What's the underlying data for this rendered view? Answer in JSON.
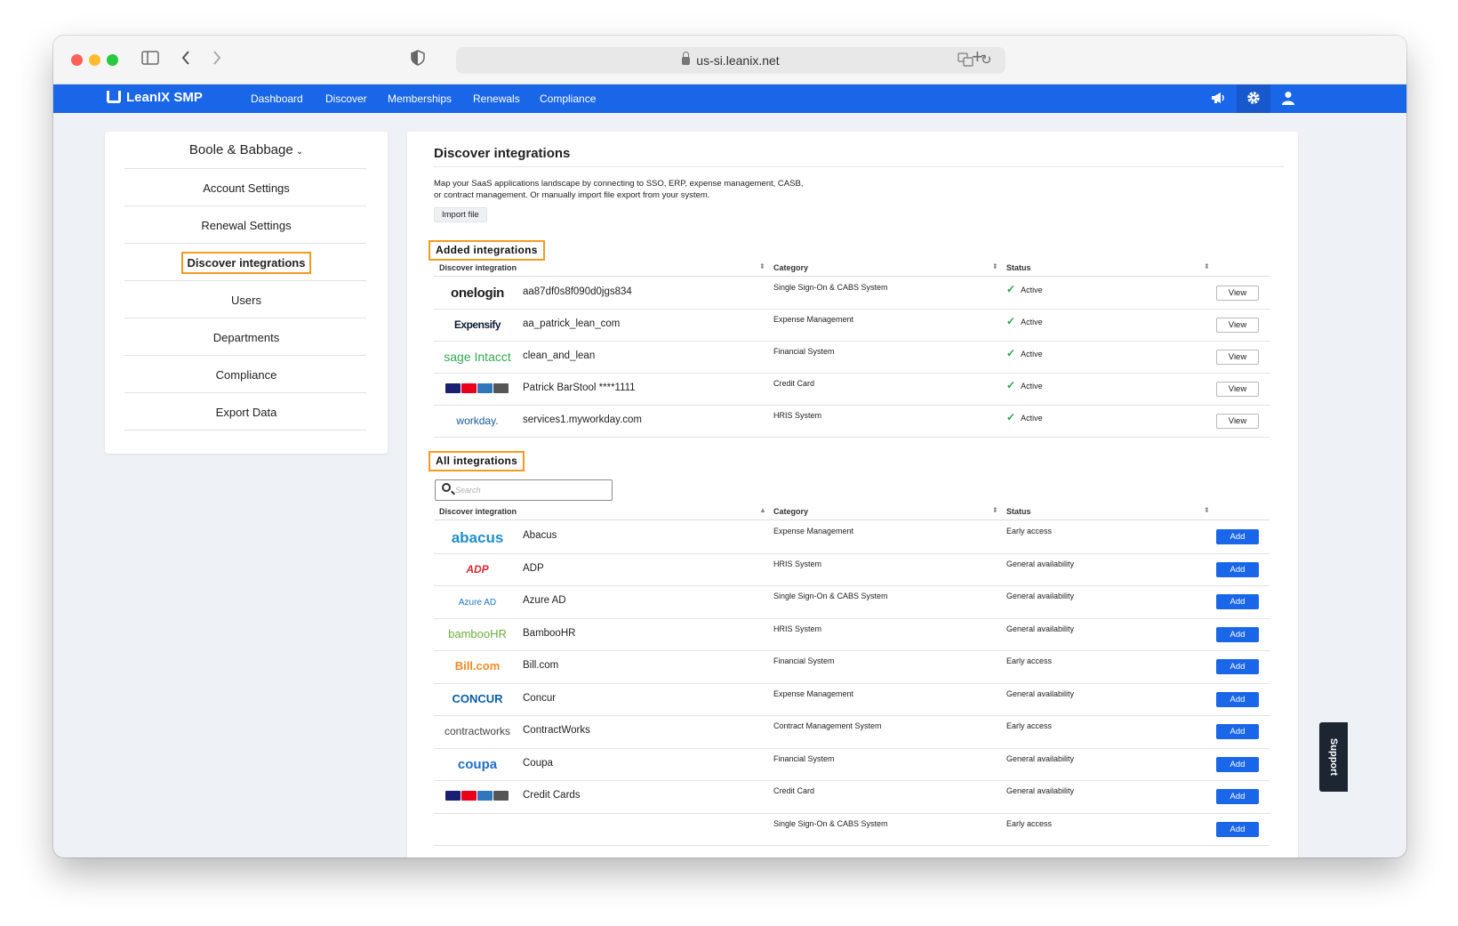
{
  "browser": {
    "url": "us-si.leanix.net"
  },
  "nav": {
    "brand": "LeanIX SMP",
    "items": [
      "Dashboard",
      "Discover",
      "Memberships",
      "Renewals",
      "Compliance"
    ]
  },
  "sidebar": {
    "org": "Boole & Babbage",
    "items": [
      "Account Settings",
      "Renewal Settings",
      "Discover integrations",
      "Users",
      "Departments",
      "Compliance",
      "Export Data"
    ]
  },
  "main": {
    "title": "Discover integrations",
    "description": "Map your SaaS applications landscape by connecting to SSO, ERP, expense management, CASB, or contract management. Or manually import file export from your system.",
    "import_label": "Import file",
    "added_label": "Added integrations",
    "all_label": "All integrations",
    "search_placeholder": "Search",
    "columns": {
      "integration": "Discover integration",
      "category": "Category",
      "status": "Status"
    },
    "view_label": "View",
    "add_label": "Add",
    "added": [
      {
        "logo": "onelogin",
        "name": "aa87df0s8f090d0jgs834",
        "category": "Single Sign-On & CABS System",
        "status": "Active"
      },
      {
        "logo": "Expensify",
        "name": "aa_patrick_lean_com",
        "category": "Expense Management",
        "status": "Active"
      },
      {
        "logo": "sage Intacct",
        "name": "clean_and_lean",
        "category": "Financial System",
        "status": "Active"
      },
      {
        "logo": "credit-cards",
        "name": "Patrick BarStool ****1111",
        "category": "Credit Card",
        "status": "Active"
      },
      {
        "logo": "workday.",
        "name": "services1.myworkday.com",
        "category": "HRIS System",
        "status": "Active"
      }
    ],
    "all": [
      {
        "logo": "abacus",
        "name": "Abacus",
        "category": "Expense Management",
        "status": "Early access"
      },
      {
        "logo": "ADP",
        "name": "ADP",
        "category": "HRIS System",
        "status": "General availability"
      },
      {
        "logo": "Azure AD",
        "name": "Azure AD",
        "category": "Single Sign-On & CABS System",
        "status": "General availability"
      },
      {
        "logo": "bambooHR",
        "name": "BambooHR",
        "category": "HRIS System",
        "status": "General availability"
      },
      {
        "logo": "Bill.com",
        "name": "Bill.com",
        "category": "Financial System",
        "status": "Early access"
      },
      {
        "logo": "CONCUR",
        "name": "Concur",
        "category": "Expense Management",
        "status": "General availability"
      },
      {
        "logo": "contractworks",
        "name": "ContractWorks",
        "category": "Contract Management System",
        "status": "Early access"
      },
      {
        "logo": "coupa",
        "name": "Coupa",
        "category": "Financial System",
        "status": "General availability"
      },
      {
        "logo": "credit-cards",
        "name": "Credit Cards",
        "category": "Credit Card",
        "status": "General availability"
      },
      {
        "logo": "",
        "name": "",
        "category": "Single Sign-On & CABS System",
        "status": "Early access"
      }
    ]
  },
  "support_label": "Support",
  "colors": {
    "brand_blue": "#1a66e8",
    "highlight_orange": "#f39b1f",
    "active_green": "#23a047"
  }
}
